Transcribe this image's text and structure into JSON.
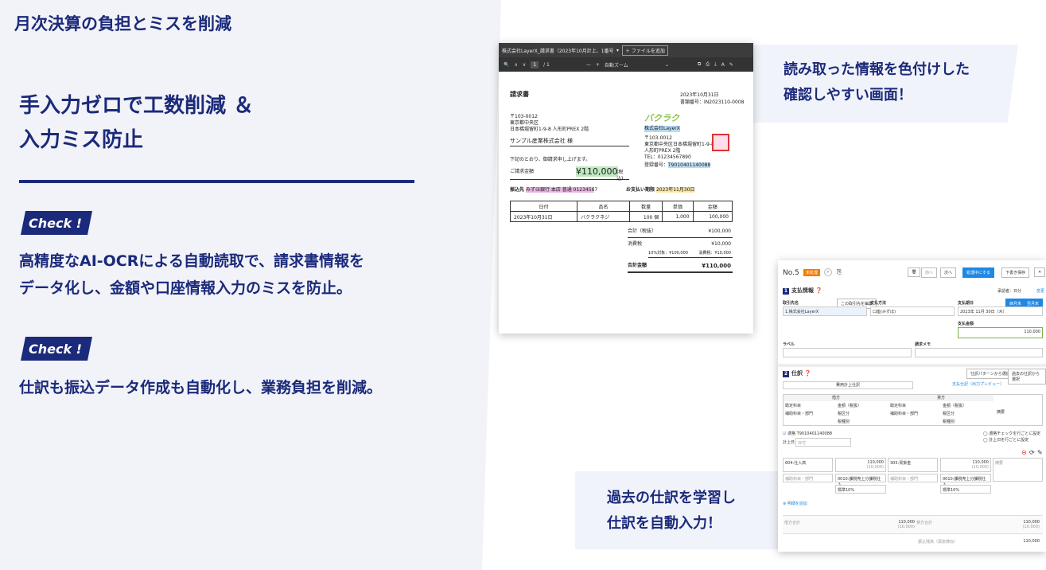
{
  "left": {
    "header": "月次決算の負担とミスを削減",
    "title_line1": "手入力ゼロで工数削減 ＆",
    "title_line2": "入力ミス防止",
    "check_label": "Check !",
    "desc1_line1": "高精度なAI-OCRによる自動読取で、請求書情報を",
    "desc1_line2": "データ化し、金額や口座情報入力のミスを防止。",
    "desc2": "仕訳も振込データ作成も自動化し、業務負担を削減。"
  },
  "callouts": {
    "top_line1": "読み取った情報を色付けした",
    "top_line2": "確認しやすい画面！",
    "bottom_line1": "過去の仕訳を学習し",
    "bottom_line2": "仕訳を自動入力！"
  },
  "pdf": {
    "filename": "株式会社LayerX_請求書（2023年10月計上、1番号あり）.pdf",
    "add_file": "＋ ファイルを追加",
    "page": "1",
    "page_total": "/ 1",
    "zoom": "自動ズーム",
    "doc_title": "請求書",
    "date": "2023年10月31日",
    "inv_no": "書類番号：IN2023110-0008",
    "to_zip": "〒103-0012",
    "to_addr1": "東京都中央区",
    "to_addr2": "日本橋堀留町1-9-8 人形町PREX 2階",
    "to_name": "サンプル産業株式会社 様",
    "message": "下記のとおり、御請求申し上げます。",
    "amount_label": "ご請求金額",
    "amount": "¥110,000",
    "amount_tax": "(税込)",
    "logo": "バクラク",
    "from_name": "株式会社LayerX",
    "from_zip": "〒103-0012",
    "from_addr1": "東京都中央区日本橋堀留町1-9-8",
    "from_addr2": "人形町PREX 2階",
    "from_tel": "TEL：01234567890",
    "reg_label": "登録番号：",
    "reg_no": "T9010401140088",
    "bank_label": "振込先",
    "bank": "みずほ銀行 本店 普通 0123456",
    "bank_suffix": "7",
    "due_label": "お支払い期限",
    "due": "2023年11月30日",
    "headers": [
      "日付",
      "品名",
      "数量",
      "単価",
      "金額"
    ],
    "row": [
      "2023年10月31日",
      "バクラクネジ",
      "100 個",
      "1,000",
      "100,000"
    ],
    "subtotal_label": "合計（税抜）",
    "subtotal": "¥100,000",
    "tax_label": "消費税",
    "tax": "¥10,000",
    "tax_note1": "10%対象：¥100,000",
    "tax_note2": "消費税：¥10,000",
    "total_label": "合計金額",
    "total": "¥110,000"
  },
  "form": {
    "no": "No.5",
    "badge": "未処理",
    "nav_prev": "前へ",
    "nav_next": "次へ",
    "btn_processing": "処理中にする",
    "btn_draft": "下書き保存",
    "sec1": "支払情報",
    "approval": "承認者：日分",
    "change": "変更",
    "payee_label": "取引先名",
    "payee_btn": "この取引先を編集",
    "payee": "1.株式会社LayerX",
    "method_label": "支払方法",
    "method": "口座(みずほ)",
    "due_label": "支払期日",
    "due_btn1": "締月末",
    "due_btn2": "翌月末",
    "due": "2023年 11月 30日（木）",
    "amount_label": "支払金額",
    "amount": "110,000",
    "label_label": "ラベル",
    "memo_label": "請求メモ",
    "sec2": "仕訳",
    "pattern_btn": "仕訳パターンから選択",
    "past_btn": "過去の仕訳から選択",
    "tab1": "費用計上仕訳",
    "tab2": "支払仕訳（出力プレビュー）",
    "debit": "借方",
    "credit": "貸方",
    "col_account": "勘定科目",
    "col_amount": "金額（税抜）",
    "col_sub": "補助科目・部門",
    "col_taxcat": "税区分",
    "col_taxtype": "税種別",
    "col_desc": "摘要",
    "reg_no": "適格 T9010401140088",
    "check_opt1": "適格チェックを行ごとに設定",
    "check_opt2": "計上日を行ごとに設定",
    "post_date_label": "計上日",
    "post_date": "日付",
    "d_account": "604:仕入高",
    "d_amount": "110,000",
    "d_amount_sub": "(10,000)",
    "c_account": "305:買掛金",
    "c_amount": "110,000",
    "c_amount_sub": "(10,000)",
    "d_tax": "0010:課税売上分課税仕入",
    "c_tax": "0010:課税売上分課税仕入",
    "d_rate": "標準10%",
    "c_rate": "標準10%",
    "sub_ph": "補助科目・部門",
    "desc_ph": "摘要",
    "add_detail": "明細を追加",
    "debit_total_label": "借方合計",
    "credit_total_label": "貸方合計",
    "debit_total": "110,000",
    "debit_total_sub": "(10,000)",
    "credit_total": "110,000",
    "credit_total_sub": "(10,000)",
    "transfer_label": "振込残高（源泉徴収）",
    "transfer": "110,000"
  }
}
